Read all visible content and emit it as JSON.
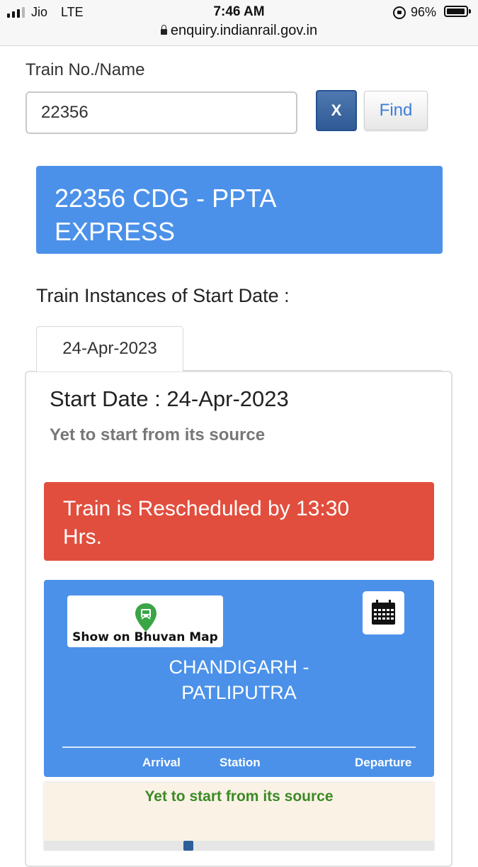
{
  "status_bar": {
    "carrier": "Jio",
    "network": "LTE",
    "time": "7:46 AM",
    "url": "enquiry.indianrail.gov.in",
    "battery_percent": "96%",
    "battery_level": 0.96,
    "signal_bars_filled": 3,
    "signal_bars_total": 4,
    "icons": [
      "signal-icon",
      "lock-icon",
      "rotation-lock-icon",
      "battery-icon"
    ]
  },
  "search": {
    "label": "Train No./Name",
    "value": "22356",
    "clear_label": "X",
    "find_label": "Find"
  },
  "train": {
    "title_line1": "22356 CDG - PPTA",
    "title_line2": "EXPRESS"
  },
  "instances": {
    "heading": "Train Instances of Start Date :",
    "tabs": [
      "24-Apr-2023"
    ],
    "selected_tab": 0
  },
  "detail": {
    "start_date_text": "Start Date : 24-Apr-2023",
    "status_text": "Yet to start from its source",
    "alert_line1": "Train is Rescheduled by 13:30",
    "alert_line2": "Hrs.",
    "map_button_label": "Show on Bhuvan Map",
    "route_line1": "CHANDIGARH -",
    "route_line2": "PATLIPUTRA",
    "columns": [
      "Arrival",
      "Station",
      "Departure"
    ],
    "source_status": "Yet to start from its source"
  },
  "colors": {
    "primary_blue": "#4b91e9",
    "alert_red": "#e14e3e",
    "success_green": "#3b8a24",
    "muted_gray": "#777777",
    "info_bg": "#fbf2e6"
  }
}
